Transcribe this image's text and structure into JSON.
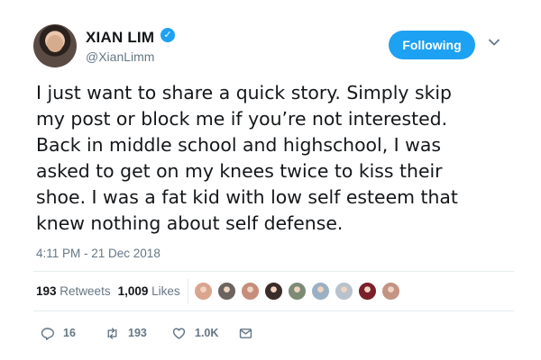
{
  "author": {
    "name": "XIAN LIM",
    "handle": "@XianLimm",
    "verified_icon": "✓"
  },
  "follow_button": {
    "label": "Following",
    "color": "#1da1f2"
  },
  "tweet": {
    "text": "I just want to share a quick story. Simply skip\nmy post or block me if you’re not interested.\nBack in middle school and highschool, I was\nasked to get on my knees twice to kiss their\nshoe. I was a fat kid with low self esteem that\nknew nothing about self defense.",
    "timestamp": "4:11 PM - 21 Dec 2018"
  },
  "stats": {
    "retweets_count": "193",
    "retweets_label": "Retweets",
    "likes_count": "1,009",
    "likes_label": "Likes"
  },
  "likers": [
    {
      "color": "#d9a58f"
    },
    {
      "color": "#6b6360"
    },
    {
      "color": "#c58e7a"
    },
    {
      "color": "#3a2c28"
    },
    {
      "color": "#7d8a74"
    },
    {
      "color": "#9bb0c2"
    },
    {
      "color": "#b8c2cc"
    },
    {
      "color": "#7a1f2b"
    },
    {
      "color": "#c49383"
    }
  ],
  "actions": {
    "reply_count": "16",
    "retweet_count": "193",
    "like_count": "1.0K"
  }
}
